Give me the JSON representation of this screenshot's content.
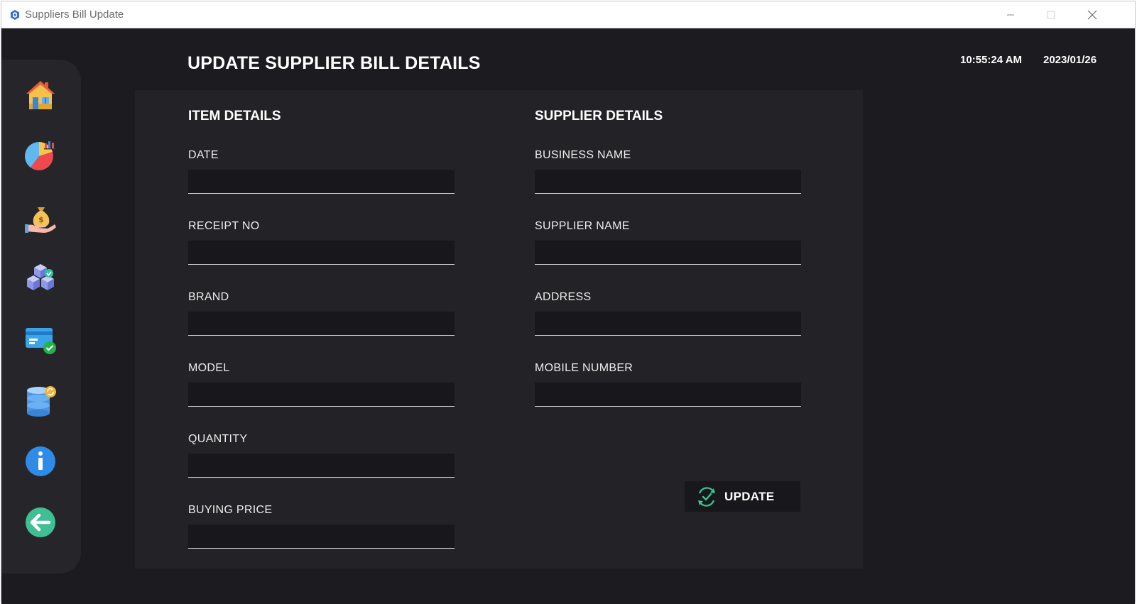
{
  "window": {
    "title": "Suppliers Bill Update"
  },
  "header": {
    "title": "UPDATE SUPPLIER BILL DETAILS",
    "time": "10:55:24 AM",
    "date": "2023/01/26"
  },
  "sidebar": {
    "items": [
      {
        "name": "home",
        "icon": "house-icon"
      },
      {
        "name": "reports",
        "icon": "pie-chart-icon"
      },
      {
        "name": "sales",
        "icon": "money-bag-hand-icon"
      },
      {
        "name": "inventory",
        "icon": "boxes-check-icon"
      },
      {
        "name": "payments",
        "icon": "card-check-icon"
      },
      {
        "name": "database",
        "icon": "database-sync-icon"
      },
      {
        "name": "about",
        "icon": "info-icon"
      },
      {
        "name": "back",
        "icon": "back-arrow-icon"
      }
    ]
  },
  "item_details": {
    "title": "ITEM DETAILS",
    "fields": [
      {
        "label": "DATE",
        "value": ""
      },
      {
        "label": "RECEIPT NO",
        "value": ""
      },
      {
        "label": "BRAND",
        "value": ""
      },
      {
        "label": "MODEL",
        "value": ""
      },
      {
        "label": "QUANTITY",
        "value": ""
      },
      {
        "label": "BUYING PRICE",
        "value": ""
      }
    ]
  },
  "supplier_details": {
    "title": "SUPPLIER DETAILS",
    "fields": [
      {
        "label": "BUSINESS NAME",
        "value": ""
      },
      {
        "label": "SUPPLIER NAME",
        "value": ""
      },
      {
        "label": "ADDRESS",
        "value": ""
      },
      {
        "label": "MOBILE NUMBER",
        "value": ""
      }
    ]
  },
  "actions": {
    "update_label": "UPDATE"
  },
  "colors": {
    "background": "#1b1b20",
    "panel": "#232327",
    "sidebar": "#26262a",
    "input": "#18181c",
    "accent_green": "#3fc38f"
  }
}
